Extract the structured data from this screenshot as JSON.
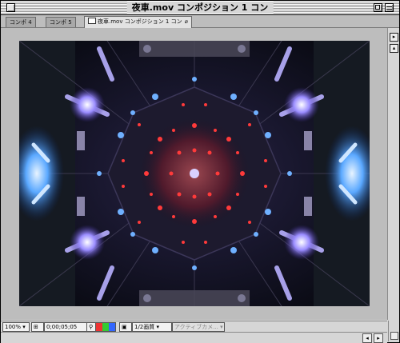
{
  "window": {
    "title": "夜車.mov コンポジション 1 コン"
  },
  "tabs": [
    {
      "label": "コンポ 4"
    },
    {
      "label": "コンポ 5"
    },
    {
      "label": "夜車.mov コンポジション 1 コン",
      "close": "⌀"
    }
  ],
  "bottom": {
    "zoom": "100% ▾",
    "timecode": "0;00;05;05",
    "resolution": "1/2画質 ▾",
    "camera": "アクティブカメ... ▾"
  },
  "colors": {
    "frame_bg": "#0b0d1c",
    "accent_blue": "#7fb6ff",
    "accent_red": "#ff3a3a"
  }
}
